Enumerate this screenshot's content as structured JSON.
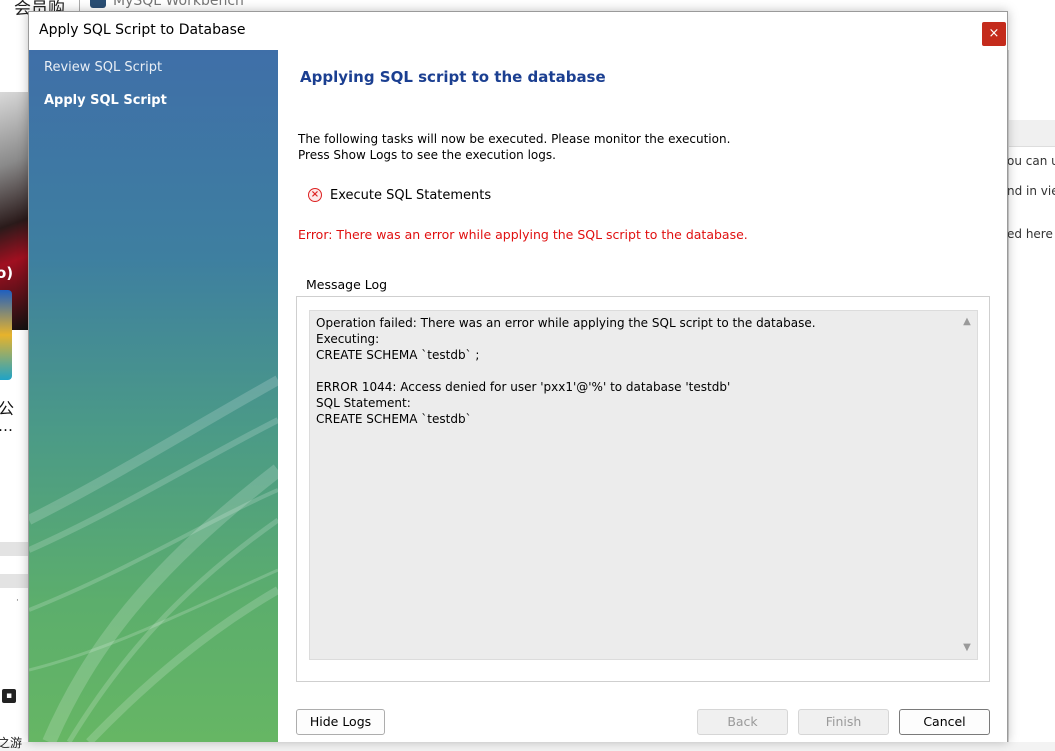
{
  "background": {
    "top_text": "会员购",
    "app_title": "MySQL Workbench",
    "left_badge": "o)",
    "left_cn": "公",
    "left_ellipsis": "…",
    "left_small": "·",
    "left_bottom_cn": "之游",
    "right_text_1": "ou can u",
    "right_text_2": "nd in vie",
    "right_text_3": "ed here v"
  },
  "dialog": {
    "title": "Apply SQL Script to Database",
    "close_label": "×"
  },
  "sidebar": {
    "items": [
      {
        "label": "Review SQL Script",
        "active": false
      },
      {
        "label": "Apply SQL Script",
        "active": true
      }
    ]
  },
  "main": {
    "heading": "Applying SQL script to the database",
    "intro_line1": "The following tasks will now be executed. Please monitor the execution.",
    "intro_line2": "Press Show Logs to see the execution logs.",
    "task": {
      "label": "Execute SQL Statements",
      "status": "error",
      "icon": "error-x-icon"
    },
    "error_message": "Error: There was an error while applying the SQL script to the database.",
    "message_log": {
      "label": "Message Log",
      "text": "Operation failed: There was an error while applying the SQL script to the database.\nExecuting:\nCREATE SCHEMA `testdb` ;\n\nERROR 1044: Access denied for user 'pxx1'@'%' to database 'testdb'\nSQL Statement:\nCREATE SCHEMA `testdb`"
    }
  },
  "buttons": {
    "hide_logs": "Hide Logs",
    "back": "Back",
    "finish": "Finish",
    "cancel": "Cancel"
  },
  "colors": {
    "heading": "#1b3f91",
    "error": "#e01010",
    "close": "#c42b1c"
  }
}
